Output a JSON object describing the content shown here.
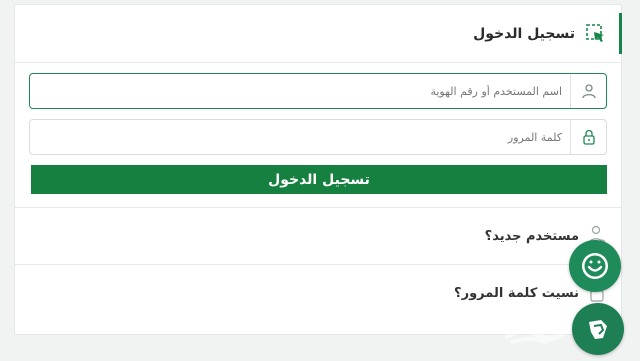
{
  "header": {
    "title": "تسجيل الدخول",
    "icon": "login-select-icon"
  },
  "form": {
    "username_placeholder": "اسم المستخدم أو رقم الهوية",
    "username_value": "",
    "username_icon": "user-icon",
    "password_placeholder": "كلمة المرور",
    "password_value": "",
    "password_icon": "lock-icon",
    "submit_label": "تسجيل الدخول"
  },
  "links": {
    "new_user_label": "مستخدم جديد؟",
    "new_user_icon": "user-plus-icon",
    "forgot_label": "نسيت كلمة المرور؟",
    "forgot_icon": "lock-question-icon"
  },
  "floating": {
    "chat_icon": "chat-bot-icon",
    "scroll_icon": "accessibility-icon"
  },
  "colors": {
    "accent": "#15803f",
    "active_border": "#1c8a52",
    "fab": "#1f8a5a"
  }
}
